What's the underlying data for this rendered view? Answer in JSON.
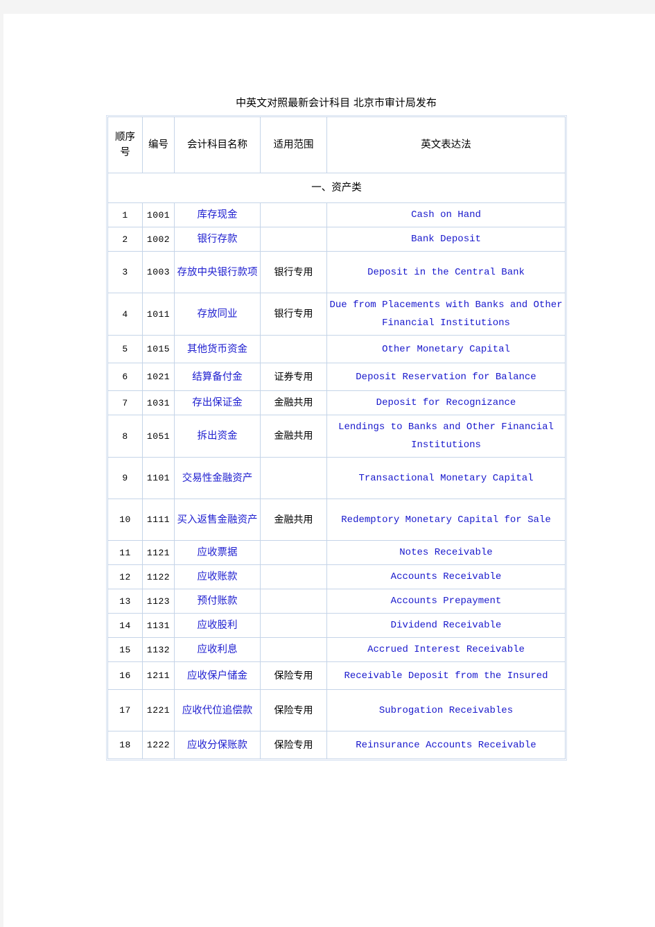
{
  "document": {
    "title": "中英文对照最新会计科目 北京市审计局发布"
  },
  "table": {
    "columns": [
      {
        "key": "seq",
        "label": "顺序号"
      },
      {
        "key": "code",
        "label": "编号"
      },
      {
        "key": "name",
        "label": "会计科目名称"
      },
      {
        "key": "scope",
        "label": "适用范围"
      },
      {
        "key": "en",
        "label": "英文表达法"
      }
    ],
    "section_header": "一、资产类",
    "rows": [
      {
        "seq": "1",
        "code": "1001",
        "name": "库存现金",
        "scope": "",
        "en": "Cash on Hand"
      },
      {
        "seq": "2",
        "code": "1002",
        "name": "银行存款",
        "scope": "",
        "en": "Bank Deposit"
      },
      {
        "seq": "3",
        "code": "1003",
        "name": "存放中央银行款项",
        "scope": "银行专用",
        "en": "Deposit in the Central Bank"
      },
      {
        "seq": "4",
        "code": "1011",
        "name": "存放同业",
        "scope": "银行专用",
        "en": "Due from Placements with Banks and Other Financial Institutions"
      },
      {
        "seq": "5",
        "code": "1015",
        "name": "其他货币资金",
        "scope": "",
        "en": "Other Monetary Capital"
      },
      {
        "seq": "6",
        "code": "1021",
        "name": "结算备付金",
        "scope": "证券专用",
        "en": "Deposit Reservation for Balance"
      },
      {
        "seq": "7",
        "code": "1031",
        "name": "存出保证金",
        "scope": "金融共用",
        "en": "Deposit for Recognizance"
      },
      {
        "seq": "8",
        "code": "1051",
        "name": "拆出资金",
        "scope": "金融共用",
        "en": "Lendings to Banks and Other Financial Institutions"
      },
      {
        "seq": "9",
        "code": "1101",
        "name": "交易性金融资产",
        "scope": "",
        "en": "Transactional Monetary Capital"
      },
      {
        "seq": "10",
        "code": "1111",
        "name": "买入返售金融资产",
        "scope": "金融共用",
        "en": "Redemptory Monetary Capital for Sale"
      },
      {
        "seq": "11",
        "code": "1121",
        "name": "应收票据",
        "scope": "",
        "en": "Notes Receivable"
      },
      {
        "seq": "12",
        "code": "1122",
        "name": "应收账款",
        "scope": "",
        "en": "Accounts Receivable"
      },
      {
        "seq": "13",
        "code": "1123",
        "name": "预付账款",
        "scope": "",
        "en": "Accounts Prepayment"
      },
      {
        "seq": "14",
        "code": "1131",
        "name": "应收股利",
        "scope": "",
        "en": "Dividend Receivable"
      },
      {
        "seq": "15",
        "code": "1132",
        "name": "应收利息",
        "scope": "",
        "en": "Accrued Interest Receivable"
      },
      {
        "seq": "16",
        "code": "1211",
        "name": "应收保户储金",
        "scope": "保险专用",
        "en": "Receivable Deposit from the Insured"
      },
      {
        "seq": "17",
        "code": "1221",
        "name": "应收代位追偿款",
        "scope": "保险专用",
        "en": "Subrogation Receivables"
      },
      {
        "seq": "18",
        "code": "1222",
        "name": "应收分保账款",
        "scope": "保险专用",
        "en": "Reinsurance Accounts Receivable"
      }
    ]
  },
  "colors": {
    "border": "#c5d4e8",
    "chinese_account_text": "#2020d0",
    "english_text": "#1818cc",
    "page_background": "#ffffff",
    "canvas_background": "#f4f4f4"
  }
}
